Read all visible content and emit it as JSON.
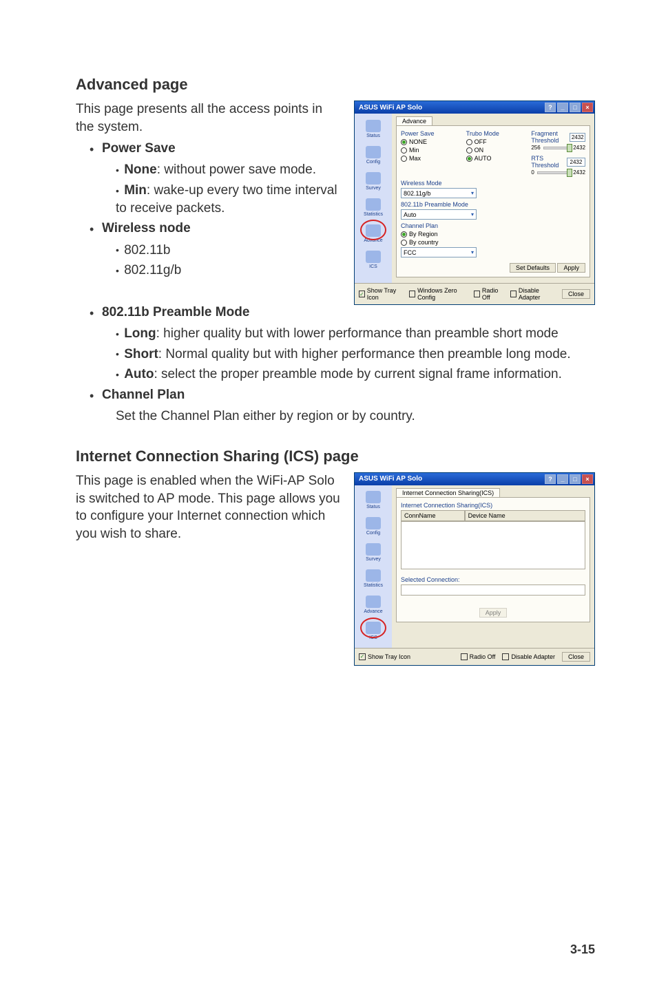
{
  "sections": {
    "advanced": {
      "heading": "Advanced page",
      "intro": "This page presents all the access points in the system.",
      "items": [
        {
          "label": "Power Save",
          "subs": [
            {
              "bold": "None",
              "text": ": without power save mode."
            },
            {
              "bold": "Min",
              "text": ": wake-up every two time interval to receive packets."
            }
          ]
        },
        {
          "label": "Wireless node",
          "subs": [
            {
              "bold": "",
              "text": "802.11b"
            },
            {
              "bold": "",
              "text": "802.11g/b"
            }
          ]
        },
        {
          "label": "802.11b Preamble Mode",
          "subs": [
            {
              "bold": "Long",
              "text": ": higher quality but with lower performance than preamble short mode"
            },
            {
              "bold": "Short",
              "text": ": Normal quality but with higher performance then preamble long mode."
            },
            {
              "bold": "Auto",
              "text": ": select the proper preamble mode by current signal frame information."
            }
          ]
        },
        {
          "label": "Channel Plan",
          "desc": "Set the Channel Plan either by region or by country."
        }
      ]
    },
    "ics": {
      "heading": "Internet Connection Sharing (ICS) page",
      "intro": "This page is enabled when the WiFi-AP Solo is switched to AP mode. This page allows you to configure your Internet connection which you wish to share."
    }
  },
  "window_shared": {
    "title": "ASUS WiFi AP Solo",
    "sidebar": [
      "Status",
      "Config",
      "Survey",
      "Statistics",
      "Advance",
      "ICS"
    ],
    "bottom": {
      "show_tray": "Show Tray Icon",
      "wzc": "Windows Zero Config",
      "radio_off": "Radio Off",
      "disable_adapter": "Disable Adapter",
      "close": "Close"
    }
  },
  "advance_window": {
    "tab": "Advance",
    "power_save_label": "Power Save",
    "power_save_opts": [
      "NONE",
      "Min",
      "Max"
    ],
    "trubo_label": "Trubo Mode",
    "trubo_opts": [
      "OFF",
      "ON",
      "AUTO"
    ],
    "wireless_mode_label": "Wireless Mode",
    "wireless_mode_value": "802.11g/b",
    "preamble_label": "802.11b Preamble Mode",
    "preamble_value": "Auto",
    "channel_plan_label": "Channel Plan",
    "channel_plan_opts": [
      "By Region",
      "By country"
    ],
    "region_value": "FCC",
    "frag_label": "Fragment Threshold",
    "frag_value": "2432",
    "frag_min": "256",
    "frag_max": "2432",
    "rts_label": "RTS Threshold",
    "rts_value": "2432",
    "rts_min": "0",
    "rts_max": "2432",
    "set_defaults": "Set Defaults",
    "apply": "Apply"
  },
  "ics_window": {
    "tab": "Internet Connection Sharing(ICS)",
    "heading": "Internet Connection Sharing(ICS)",
    "col1": "ConnName",
    "col2": "Device Name",
    "selected_label": "Selected Connection:",
    "apply": "Apply"
  },
  "page_number": "3-15"
}
